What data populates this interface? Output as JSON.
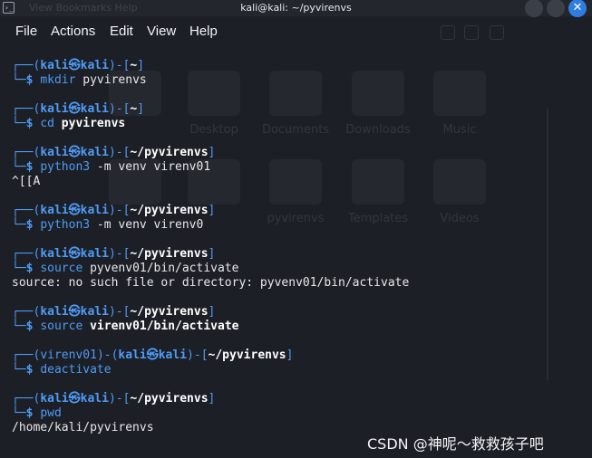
{
  "window": {
    "title": "kali@kali: ~/pyvirenvs",
    "app_icon": "terminal-icon",
    "app_icon_glyph": "›_",
    "close_glyph": "✕"
  },
  "background_ghost": {
    "menu_text": "View  Bookmarks  Help",
    "places": [
      "Desktop",
      "Documents",
      "Downloads",
      "Music",
      "pyvirenvs",
      "Templates",
      "Videos"
    ]
  },
  "menu": {
    "items": [
      "File",
      "Actions",
      "Edit",
      "View",
      "Help"
    ]
  },
  "prompt": {
    "corner_top": "┌──",
    "corner_bottom": "└─",
    "dollar": "$",
    "open_paren": "(",
    "close_paren": ")",
    "dash": "-",
    "user_host": "kali㉿kali",
    "open_bracket": "[",
    "close_bracket": "]"
  },
  "session": [
    {
      "venv": "",
      "path": "~",
      "command": "mkdir",
      "arg": " pyvirenvs",
      "arg_bold": false,
      "output": []
    },
    {
      "venv": "",
      "path": "~",
      "command": "cd",
      "arg": " pyvirenvs",
      "arg_bold": true,
      "output": []
    },
    {
      "venv": "",
      "path": "~/pyvirenvs",
      "command": "python3",
      "arg": " -m venv virenv01",
      "arg_bold": false,
      "output": [
        "^[[A"
      ]
    },
    {
      "venv": "",
      "path": "~/pyvirenvs",
      "command": "python3",
      "arg": " -m venv virenv0",
      "arg_bold": false,
      "output": []
    },
    {
      "venv": "",
      "path": "~/pyvirenvs",
      "command": "source",
      "arg": " pyvenv01/bin/activate",
      "arg_bold": false,
      "output": [
        "source: no such file or directory: pyvenv01/bin/activate"
      ]
    },
    {
      "venv": "",
      "path": "~/pyvirenvs",
      "command": "source",
      "arg": " virenv01/bin/activate",
      "arg_bold": true,
      "output": []
    },
    {
      "venv": "virenv01",
      "path": "~/pyvirenvs",
      "command": "deactivate",
      "arg": "",
      "arg_bold": false,
      "output": []
    },
    {
      "venv": "",
      "path": "~/pyvirenvs",
      "command": "pwd",
      "arg": "",
      "arg_bold": false,
      "output": [
        "/home/kali/pyvirenvs"
      ]
    }
  ],
  "watermark": "CSDN @神呢～救救孩子吧",
  "colors": {
    "background": "#1c1f26",
    "prompt_blue": "#4f9bf5",
    "text": "#e8e8e8",
    "close_button": "#2f7de1"
  }
}
